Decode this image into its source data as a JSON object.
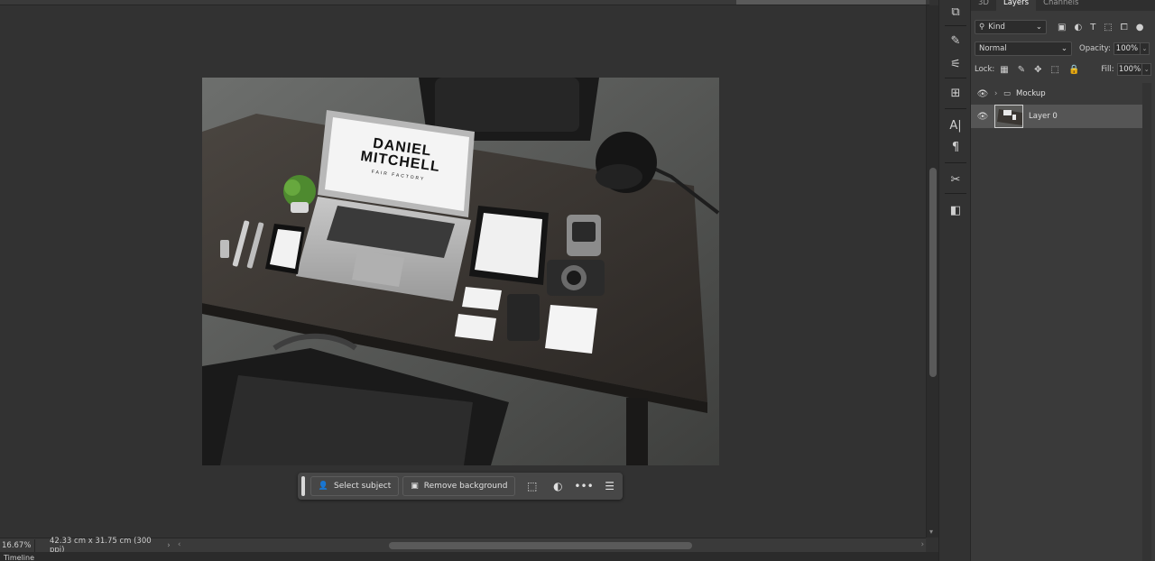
{
  "document": {
    "mockup": {
      "brand_line1": "DANIEL",
      "brand_line2": "MITCHELL",
      "tagline": "FAIR FACTORY"
    }
  },
  "taskbar": {
    "select_subject": "Select subject",
    "remove_background": "Remove background",
    "more": "•••"
  },
  "statusbar": {
    "zoom": "16.67%",
    "doc_info": "42.33 cm x 31.75 cm (300 ppi)",
    "timeline": "Timeline"
  },
  "panel": {
    "tabs": [
      "3D",
      "Layers",
      "Channels"
    ],
    "kind": "Kind",
    "blend_mode": "Normal",
    "opacity_label": "Opacity:",
    "opacity_value": "100%",
    "lock_label": "Lock:",
    "fill_label": "Fill:",
    "fill_value": "100%",
    "layers": [
      {
        "name": "Mockup",
        "type": "group"
      },
      {
        "name": "Layer 0",
        "type": "pixel",
        "selected": true
      }
    ]
  },
  "colors": {
    "canvas_bg": "#323232",
    "panel_bg": "#3a3a3a",
    "selected_layer": "#555555"
  }
}
